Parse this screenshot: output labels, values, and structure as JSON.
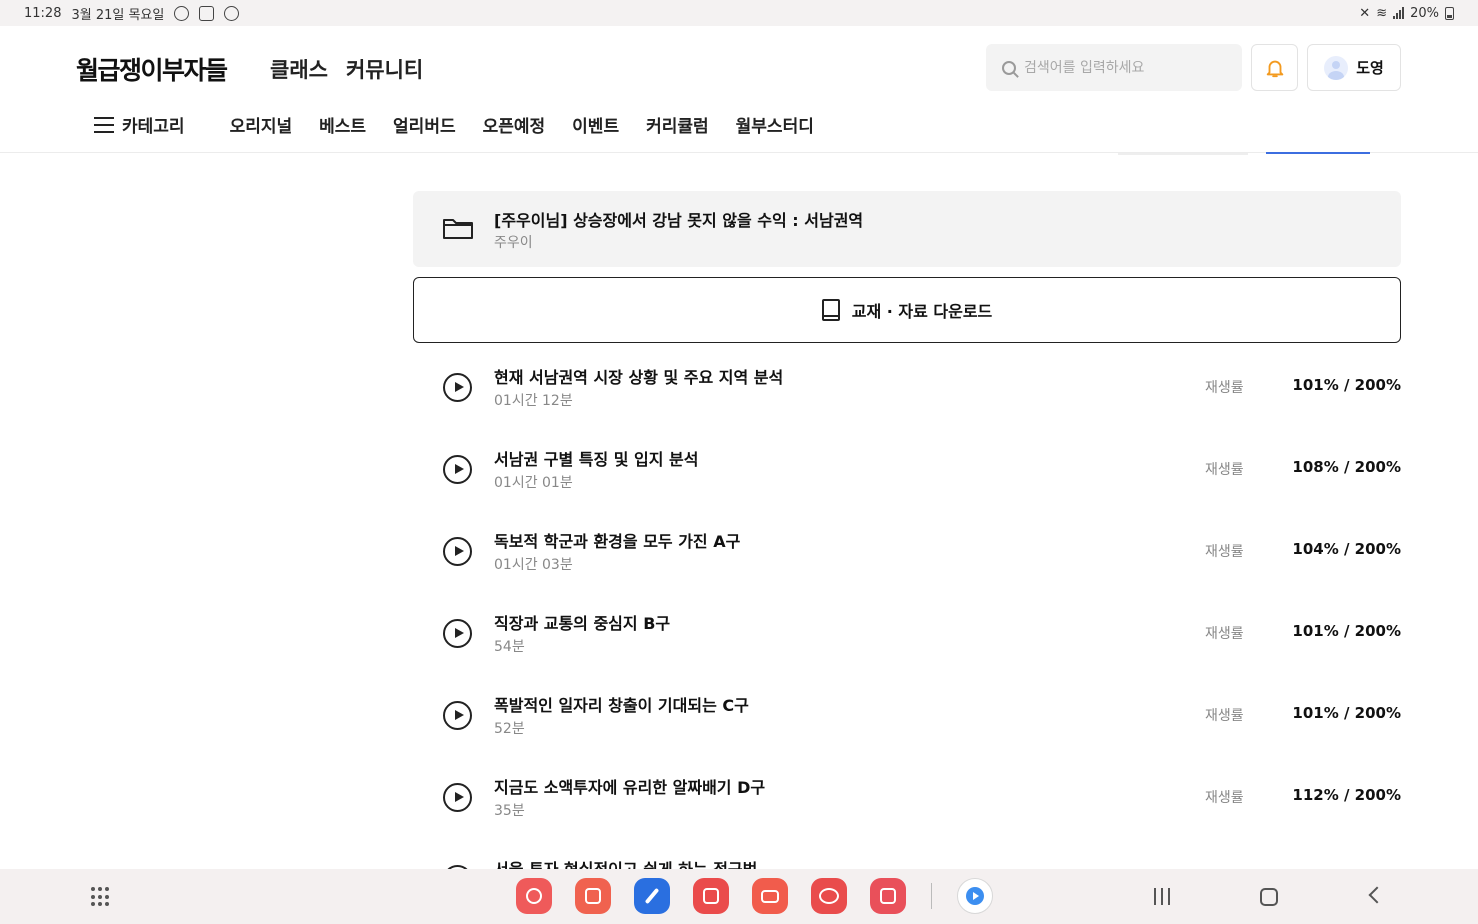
{
  "status_bar": {
    "time": "11:28",
    "date": "3월 21일 목요일",
    "battery": "20%"
  },
  "header": {
    "logo": "월급쟁이부자들",
    "top_nav": [
      "클래스",
      "커뮤니티"
    ],
    "search_placeholder": "검색어를 입력하세요",
    "user_name": "도영",
    "category_label": "카테고리",
    "sub_nav": [
      "오리지널",
      "베스트",
      "얼리버드",
      "오픈예정",
      "이벤트",
      "커리큘럼",
      "월부스터디"
    ]
  },
  "course": {
    "title": "[주우이님] 상승장에서 강남 못지 않을 수익 : 서남권역",
    "author": "주우이",
    "download_label": "교재 · 자료 다운로드"
  },
  "lectures": [
    {
      "title": "현재 서남권역 시장 상황 및 주요 지역 분석",
      "duration": "01시간 12분",
      "rate_label": "재생률",
      "rate": "101% / 200%"
    },
    {
      "title": "서남권 구별 특징 및 입지 분석",
      "duration": "01시간 01분",
      "rate_label": "재생률",
      "rate": "108% / 200%"
    },
    {
      "title": "독보적 학군과 환경을 모두 가진 A구",
      "duration": "01시간 03분",
      "rate_label": "재생률",
      "rate": "104% / 200%"
    },
    {
      "title": "직장과 교통의 중심지 B구",
      "duration": "54분",
      "rate_label": "재생률",
      "rate": "101% / 200%"
    },
    {
      "title": "폭발적인 일자리 창출이 기대되는 C구",
      "duration": "52분",
      "rate_label": "재생률",
      "rate": "101% / 200%"
    },
    {
      "title": "지금도 소액투자에 유리한 알짜배기 D구",
      "duration": "35분",
      "rate_label": "재생률",
      "rate": "112% / 200%"
    },
    {
      "title": "서울 투자 현실적이고 쉽게 하는 접근법",
      "duration": "",
      "rate_label": "",
      "rate": ""
    }
  ],
  "colors": {
    "accent_blue": "#3c6ee0",
    "bell_orange": "#f39a1f",
    "taskbar_bg": "#f4f0f0"
  },
  "taskbar": {
    "apps": [
      {
        "icon": "flower-app-icon",
        "color": "#ef5a5a"
      },
      {
        "icon": "notes-app-icon",
        "color": "#f0624f"
      },
      {
        "icon": "pen-app-icon",
        "color": "#2a6fe0"
      },
      {
        "icon": "video-app-icon",
        "color": "#ea4b4b"
      },
      {
        "icon": "folder-app-icon",
        "color": "#f15c4c"
      },
      {
        "icon": "browser-app-icon",
        "color": "#e94c4c"
      },
      {
        "icon": "camera-app-icon",
        "color": "#e9505a"
      },
      {
        "icon": "player-app-icon",
        "color": "#ffffff"
      }
    ]
  }
}
